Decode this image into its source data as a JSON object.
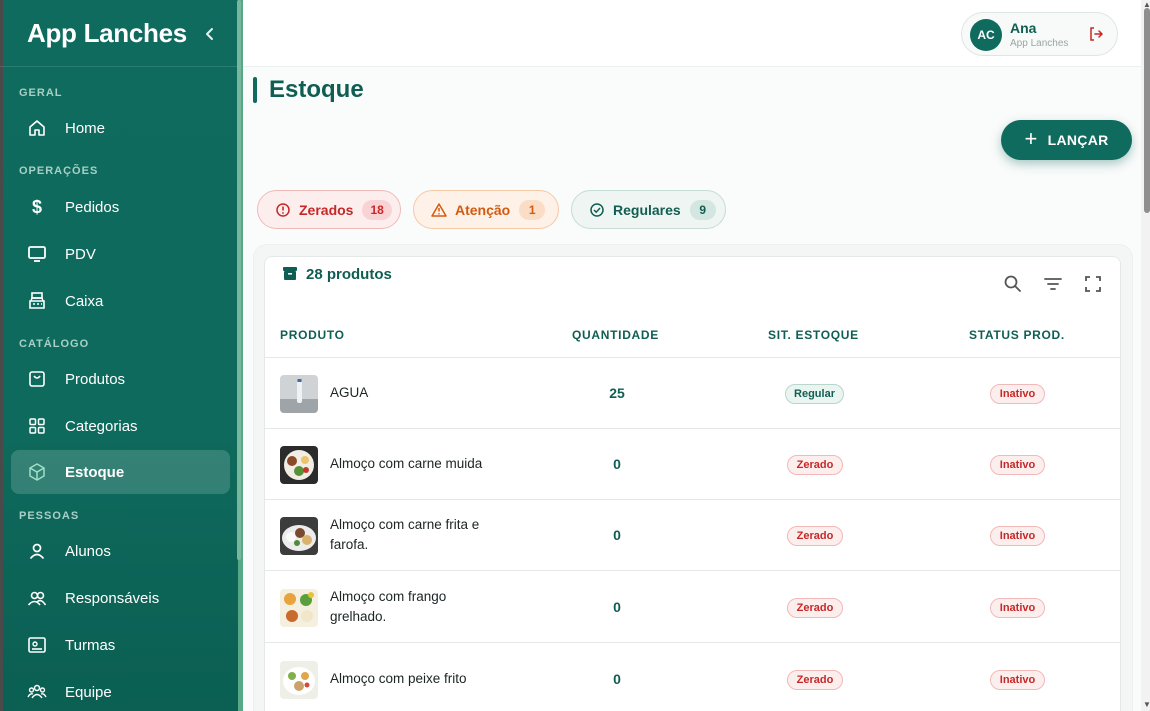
{
  "sidebar": {
    "brand": "App Lanches",
    "sections": {
      "geral": "GERAL",
      "operacoes": "OPERAÇÕES",
      "catalogo": "CATÁLOGO",
      "pessoas": "PESSOAS"
    },
    "items": [
      {
        "label": "Home",
        "icon": "home-icon"
      },
      {
        "label": "Pedidos",
        "icon": "dollar-icon"
      },
      {
        "label": "PDV",
        "icon": "monitor-icon"
      },
      {
        "label": "Caixa",
        "icon": "cash-register-icon"
      },
      {
        "label": "Produtos",
        "icon": "bag-icon"
      },
      {
        "label": "Categorias",
        "icon": "grid-icon"
      },
      {
        "label": "Estoque",
        "icon": "box-icon",
        "active": true
      },
      {
        "label": "Alunos",
        "icon": "person-icon"
      },
      {
        "label": "Responsáveis",
        "icon": "people-icon"
      },
      {
        "label": "Turmas",
        "icon": "classroom-icon"
      },
      {
        "label": "Equipe",
        "icon": "team-icon"
      }
    ]
  },
  "user": {
    "initials": "AC",
    "name": "Ana",
    "subtitle": "App Lanches"
  },
  "page": {
    "title": "Estoque",
    "launch_label": "LANÇAR"
  },
  "filters": [
    {
      "label": "Zerados",
      "count": "18",
      "color": "#c62828"
    },
    {
      "label": "Atenção",
      "count": "1",
      "color": "#d55a0e"
    },
    {
      "label": "Regulares",
      "count": "9",
      "color": "#125e52"
    }
  ],
  "table": {
    "count_label": "28 produtos",
    "columns": [
      "PRODUTO",
      "QUANTIDADE",
      "SIT. ESTOQUE",
      "STATUS PROD."
    ],
    "rows": [
      {
        "name": "AGUA",
        "qty": "25",
        "stock": "Regular",
        "status": "Inativo"
      },
      {
        "name": "Almoço com carne muida",
        "qty": "0",
        "stock": "Zerado",
        "status": "Inativo"
      },
      {
        "name": "Almoço com carne frita e farofa.",
        "qty": "0",
        "stock": "Zerado",
        "status": "Inativo"
      },
      {
        "name": "Almoço com frango grelhado.",
        "qty": "0",
        "stock": "Zerado",
        "status": "Inativo"
      },
      {
        "name": "Almoço com peixe frito",
        "qty": "0",
        "stock": "Zerado",
        "status": "Inativo"
      }
    ]
  },
  "colors": {
    "primary": "#0f6b5e",
    "danger": "#c62828",
    "warning": "#d55a0e"
  }
}
